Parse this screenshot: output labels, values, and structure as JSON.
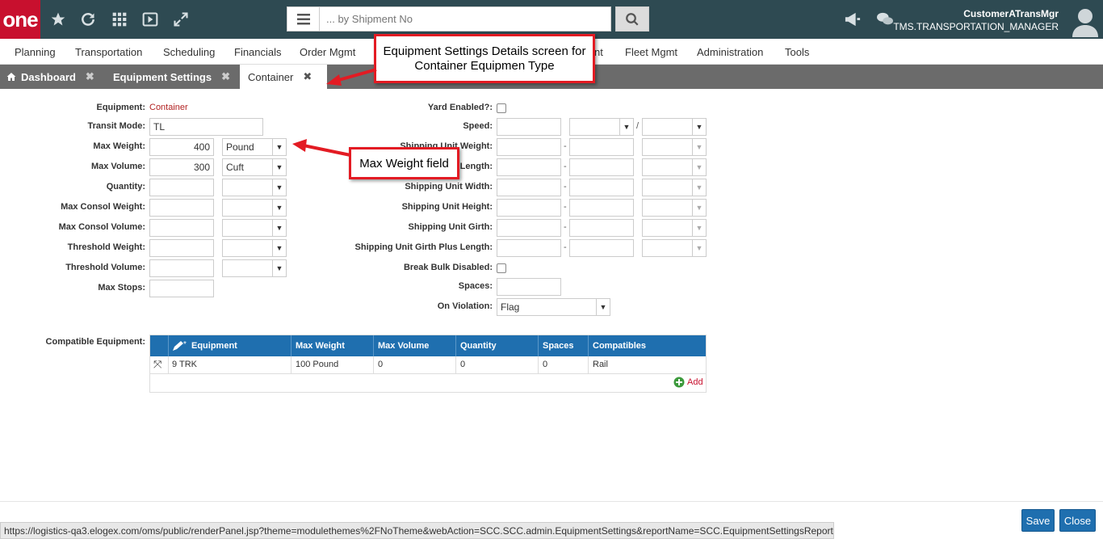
{
  "header": {
    "logo": "one",
    "search_placeholder": "... by Shipment No",
    "user_name": "CustomerATransMgr",
    "user_role": "TMS.TRANSPORTATION_MANAGER"
  },
  "menu": [
    "Planning",
    "Transportation",
    "Scheduling",
    "Financials",
    "Order Mgmt",
    "nt",
    "Fleet Mgmt",
    "Administration",
    "Tools"
  ],
  "tabs": [
    {
      "label": "Dashboard"
    },
    {
      "label": "Equipment Settings"
    },
    {
      "label": "Container"
    }
  ],
  "form_left": {
    "equipment_label": "Equipment:",
    "equipment_value": "Container",
    "transit_mode_label": "Transit Mode:",
    "transit_mode_value": "TL",
    "max_weight_label": "Max Weight:",
    "max_weight_value": "400",
    "max_weight_unit": "Pound",
    "max_volume_label": "Max Volume:",
    "max_volume_value": "300",
    "max_volume_unit": "Cuft",
    "quantity_label": "Quantity:",
    "max_consol_weight_label": "Max Consol Weight:",
    "max_consol_volume_label": "Max Consol Volume:",
    "threshold_weight_label": "Threshold Weight:",
    "threshold_volume_label": "Threshold Volume:",
    "max_stops_label": "Max Stops:"
  },
  "form_right": {
    "yard_enabled_label": "Yard Enabled?:",
    "speed_label": "Speed:",
    "speed_separator": "/",
    "shipping_unit_weight_label": "Shipping Unit Weight:",
    "shipping_unit_length_label": "Length:",
    "shipping_unit_width_label": "Shipping Unit Width:",
    "shipping_unit_height_label": "Shipping Unit Height:",
    "shipping_unit_girth_label": "Shipping Unit Girth:",
    "shipping_unit_girth_plus_length_label": "Shipping Unit Girth Plus Length:",
    "break_bulk_disabled_label": "Break Bulk Disabled:",
    "spaces_label": "Spaces:",
    "on_violation_label": "On Violation:",
    "on_violation_value": "Flag",
    "range_separator": "-"
  },
  "compatible": {
    "label": "Compatible Equipment:",
    "columns": [
      "Equipment",
      "Max Weight",
      "Max Volume",
      "Quantity",
      "Spaces",
      "Compatibles"
    ],
    "rows": [
      {
        "equipment": "9 TRK",
        "max_weight": "100 Pound",
        "max_volume": "0",
        "quantity": "0",
        "spaces": "0",
        "compatibles": "Rail"
      }
    ],
    "add_label": "Add"
  },
  "callouts": {
    "screen": "Equipment Settings Details screen for Container Equipmen Type",
    "field": "Max Weight field"
  },
  "status_url": "https://logistics-qa3.elogex.com/oms/public/renderPanel.jsp?theme=modulethemes%2FNoTheme&webAction=SCC.SCC.admin.EquipmentSettings&reportName=SCC.EquipmentSettingsReport#",
  "buttons": {
    "save": "Save",
    "close": "Close"
  },
  "colors": {
    "header": "#2e4a52",
    "logo": "#c8102e",
    "grid_header": "#1f6faf",
    "callout_border": "#e31b23"
  }
}
